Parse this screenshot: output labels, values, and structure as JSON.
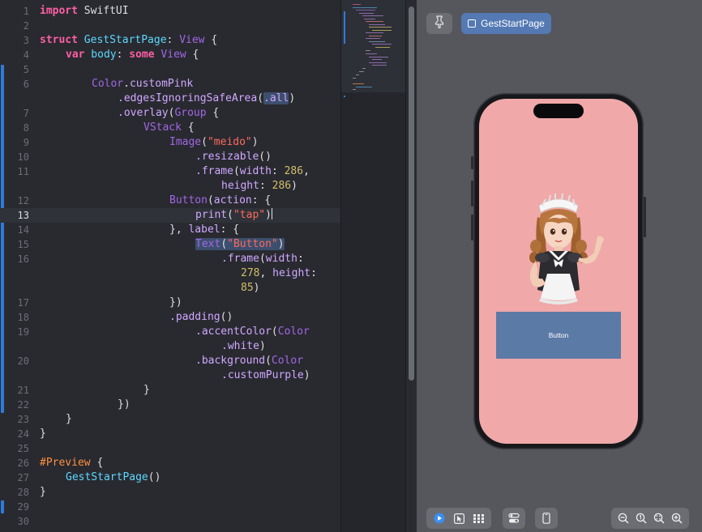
{
  "editor": {
    "line_numbers": [
      "1",
      "2",
      "3",
      "4",
      "5",
      "6",
      "",
      "7",
      "8",
      "9",
      "10",
      "11",
      "",
      "12",
      "13",
      "14",
      "15",
      "16",
      "",
      "",
      "17",
      "18",
      "19",
      "",
      "20",
      "",
      "21",
      "22",
      "23",
      "24",
      "25",
      "26",
      "27",
      "28",
      "29",
      "30"
    ],
    "current_line": "13"
  },
  "code": {
    "l1_kw": "import",
    "l1_mod": " SwiftUI",
    "l3_kw": "struct",
    "l3_name": " GestStartPage",
    "l3_colon": ": ",
    "l3_type": "View",
    "l3_brace": " {",
    "l4_kw1": "var",
    "l4_prop": " body",
    "l4_colon": ": ",
    "l4_kw2": "some",
    "l4_sp": " ",
    "l4_type": "View",
    "l4_brace": " {",
    "l6_type": "Color",
    "l6_dot": ".",
    "l6_prop": "customPink",
    "l6b_fn": ".edgesIgnoringSafeArea",
    "l6b_open": "(",
    "l6b_arg": ".all",
    "l6b_close": ")",
    "l7_fn": ".overlay",
    "l7_paren": "(",
    "l7_type": "Group",
    "l7_brace": " {",
    "l8_type": "VStack",
    "l8_brace": " {",
    "l9_type": "Image",
    "l9_open": "(",
    "l9_str": "\"meido\"",
    "l9_close": ")",
    "l10_fn": ".resizable",
    "l10_paren": "()",
    "l11_fn": ".frame",
    "l11_open": "(",
    "l11_arg": "width",
    "l11_colon": ": ",
    "l11_num": "286",
    "l11_comma": ",",
    "l11b_arg": "height",
    "l11b_colon": ": ",
    "l11b_num": "286",
    "l11b_close": ")",
    "l12_type": "Button",
    "l12_open": "(",
    "l12_arg": "action",
    "l12_rest": ": {",
    "l13_fn": "print",
    "l13_open": "(",
    "l13_str": "\"tap\"",
    "l13_close": ")",
    "l14_text": "}, ",
    "l14_arg": "label",
    "l14_rest": ": {",
    "l15_type": "Text",
    "l15_open": "(",
    "l15_str": "\"Button\"",
    "l15_close": ")",
    "l16_fn": ".frame",
    "l16_open": "(",
    "l16_arg": "width",
    "l16_colon": ":",
    "l16b_num": "278",
    "l16b_comma": ", ",
    "l16b_arg": "height",
    "l16b_colon": ":",
    "l16c_num": "85",
    "l16c_close": ")",
    "l17_text": "})",
    "l18_fn": ".padding",
    "l18_paren": "()",
    "l19_fn": ".accentColor",
    "l19_open": "(",
    "l19_type": "Color",
    "l19b_prop": ".white",
    "l19b_close": ")",
    "l20_fn": ".background",
    "l20_open": "(",
    "l20_type": "Color",
    "l20b_prop": ".customPurple",
    "l20b_close": ")",
    "l21_text": "}",
    "l22_text": "})",
    "l23_text": "}",
    "l24_text": "}",
    "l26_dir": "#Preview",
    "l26_brace": " {",
    "l27_name": "GestStartPage",
    "l27_paren": "()",
    "l28_text": "}"
  },
  "preview": {
    "pin_icon": "pin-icon",
    "page_chip_label": "GestStartPage",
    "button_label": "Button",
    "screen_color": "#f0a8a8",
    "button_color": "#5c7aa6"
  },
  "toolbar": {
    "icons": [
      "live-play-icon",
      "selectable-cursor-icon",
      "variants-grid-icon",
      "device-settings-icon",
      "device-icon",
      "zoom-out-icon",
      "zoom-actual-icon",
      "zoom-fit-icon",
      "zoom-in-icon"
    ]
  }
}
